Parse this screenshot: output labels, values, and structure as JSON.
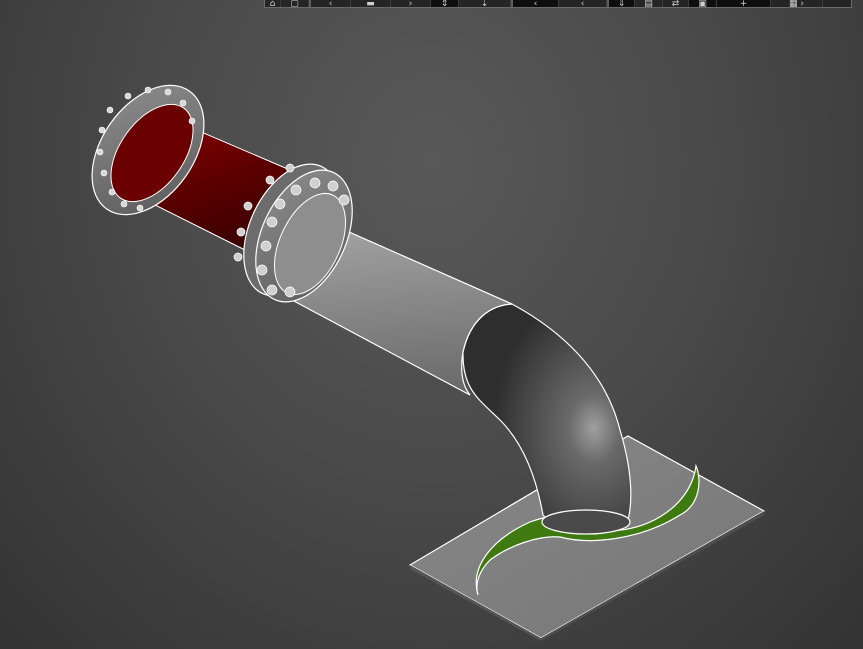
{
  "toolbar": {
    "buttons": [
      {
        "icon": "view-cube-icon"
      },
      {
        "icon": "zoom-extents-icon"
      },
      {
        "icon": "pan-icon"
      },
      {
        "icon": "orbit-icon"
      },
      {
        "icon": "rotate-icon"
      },
      {
        "icon": "move-icon"
      },
      {
        "icon": "snap-icon"
      },
      {
        "icon": "measure-icon"
      },
      {
        "icon": "section-icon"
      },
      {
        "icon": "layers-icon"
      },
      {
        "icon": "properties-icon"
      },
      {
        "icon": "render-icon"
      },
      {
        "icon": "settings-icon"
      },
      {
        "icon": "more-icon"
      }
    ]
  },
  "model": {
    "parts": [
      "flange-upper",
      "pipe-red",
      "flange-bolted",
      "pipe-gray",
      "elbow",
      "base-plate",
      "green-cutout"
    ],
    "colors": {
      "background": "#4a4a4a",
      "pipe_red": "#6a0000",
      "pipe_gray": "#8a8a8a",
      "elbow": "#4f4f4f",
      "plate": "#7b7b7b",
      "cutout": "#3f7a10",
      "edge": "#ffffff"
    }
  }
}
